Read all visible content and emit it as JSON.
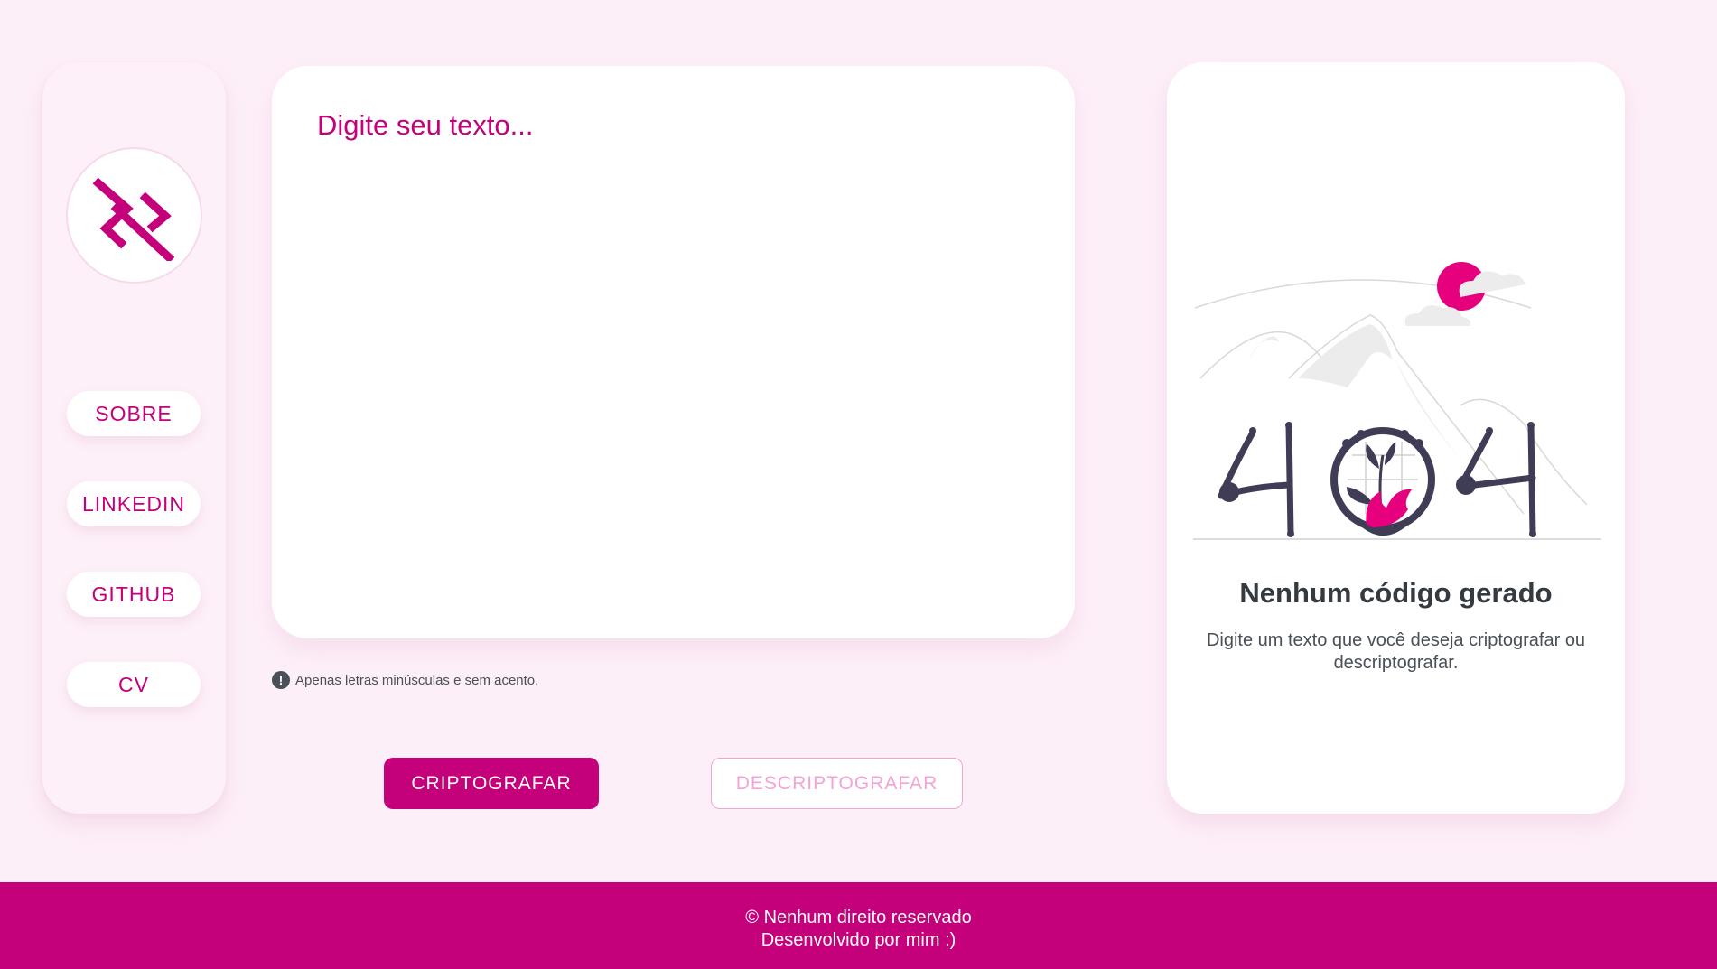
{
  "sidebar": {
    "logo_icon": "cipher-logo-icon",
    "nav": [
      {
        "label": "SOBRE"
      },
      {
        "label": "LINKEDIN"
      },
      {
        "label": "GITHUB"
      },
      {
        "label": "CV"
      }
    ]
  },
  "editor": {
    "placeholder": "Digite seu texto...",
    "value": ""
  },
  "hint": {
    "icon": "exclamation-icon",
    "text": "Apenas letras minúsculas e sem acento."
  },
  "actions": {
    "encrypt_label": "CRIPTOGRAFAR",
    "decrypt_label": "DESCRIPTOGRAFAR"
  },
  "output": {
    "illustration": "404-illustration",
    "title": "Nenhum código gerado",
    "message": "Digite um texto que você deseja criptografar ou descriptografar."
  },
  "footer": {
    "line1": "© Nenhum direito reservado",
    "line2": "Desenvolvido por mim :)"
  },
  "colors": {
    "accent": "#c4007a",
    "background": "#fdeff8",
    "secondary_button": "#f4a3d5",
    "text_dark": "#343a40"
  }
}
